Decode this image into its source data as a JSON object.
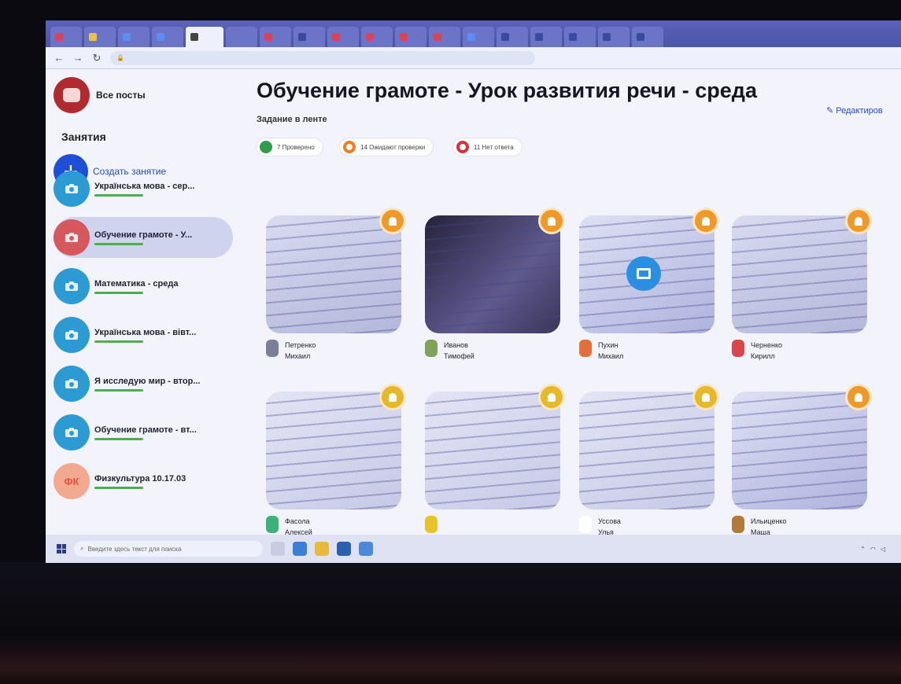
{
  "browser": {
    "tabs": [
      {
        "label": "",
        "color": "#e0405a"
      },
      {
        "label": "",
        "color": "#f0c040"
      },
      {
        "label": "",
        "color": "#5b8cf0"
      },
      {
        "label": "",
        "color": "#5b8cf0"
      },
      {
        "label": "",
        "color": "#444444",
        "active": true
      },
      {
        "label": "",
        "color": "#6b74c6"
      },
      {
        "label": "",
        "color": "#e0405a"
      },
      {
        "label": "",
        "color": "#3a4aa0"
      },
      {
        "label": "",
        "color": "#e0405a"
      },
      {
        "label": "",
        "color": "#e0405a"
      },
      {
        "label": "",
        "color": "#e0405a"
      },
      {
        "label": "",
        "color": "#e0405a"
      },
      {
        "label": "",
        "color": "#5b8cf0"
      },
      {
        "label": "",
        "color": "#3a4aa0"
      },
      {
        "label": "",
        "color": "#3a4aa0"
      },
      {
        "label": "",
        "color": "#3a4aa0"
      },
      {
        "label": "",
        "color": "#3a4aa0"
      },
      {
        "label": "",
        "color": "#3a4aa0"
      }
    ],
    "url": ""
  },
  "sidebar": {
    "header_label": "Все посты",
    "section_title": "Занятия",
    "create_label": "Создать занятие",
    "lessons": [
      {
        "title": "Українська мова - сер...",
        "time": "",
        "icon": "camera-icon",
        "color": "#2c9ad3"
      },
      {
        "title": "Обучение грамоте - У...",
        "time": "",
        "icon": "video-icon",
        "color": "#d6575c",
        "active": true
      },
      {
        "title": "Математика - среда",
        "time": "",
        "icon": "camera-icon",
        "color": "#2c9ad3"
      },
      {
        "title": "Українська мова - вівт...",
        "time": "",
        "icon": "camera-icon",
        "color": "#2c9ad3"
      },
      {
        "title": "Я исследую мир - втор...",
        "time": "",
        "icon": "camera-icon",
        "color": "#2c9ad3"
      },
      {
        "title": "Обучение грамоте - вт...",
        "time": "",
        "icon": "camera-icon",
        "color": "#2c9ad3"
      },
      {
        "title": "Физкультура 10.17.03",
        "time": "",
        "icon": "initials",
        "initials": "ФК",
        "color": "#f3a98f"
      }
    ]
  },
  "main": {
    "title": "Обучение грамоте -  Урок развития речи - среда",
    "edit_label": "✎ Редактиров",
    "subtitle": "Задание в ленте",
    "statuses": [
      {
        "label": "7 Проверено",
        "color": "green"
      },
      {
        "label": "14 Ожидают проверки",
        "color": "orange"
      },
      {
        "label": "11 Нет ответа",
        "color": "red"
      }
    ],
    "cards": [
      {
        "name": "Петренко\nМихаил",
        "time": "",
        "thumb": "paper",
        "avatar": "#7a7f99",
        "badge": "orange"
      },
      {
        "name": "Иванов\nТимофей",
        "time": "",
        "thumb": "dark",
        "avatar": "#7fa35a",
        "badge": "orange"
      },
      {
        "name": "Пухин\nМихаил",
        "time": "",
        "thumb": "blue",
        "avatar": "#e2703a",
        "badge": "orange",
        "media": true
      },
      {
        "name": "Черненко\nКирилл",
        "time": "",
        "thumb": "paper",
        "avatar": "#d6484a",
        "badge": "orange"
      },
      {
        "name": "Фасола\nАлексей",
        "time": "",
        "thumb": "paper2",
        "avatar": "#3ab27a",
        "badge": "yellow"
      },
      {
        "name": "",
        "time": "",
        "thumb": "paper2",
        "avatar": "#e6c52a",
        "badge": "yellow"
      },
      {
        "name": "Уссова\nУлья",
        "time": "",
        "thumb": "paper2",
        "avatar": "#ffffff",
        "badge": "yellow"
      },
      {
        "name": "Ильиценко\nМаша",
        "time": "",
        "thumb": "blue",
        "avatar": "#b07a3a",
        "badge": "orange"
      }
    ]
  },
  "taskbar": {
    "search_placeholder": "Введите здесь текст для поиска",
    "tray_text": ""
  }
}
